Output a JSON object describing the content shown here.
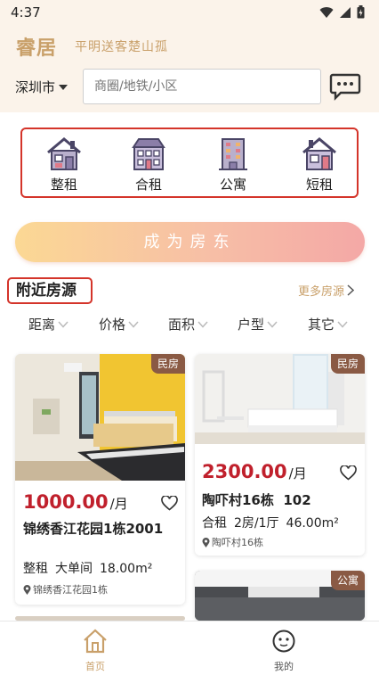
{
  "status": {
    "time": "4:37"
  },
  "brand": {
    "logo": "睿居",
    "slogan": "平明送客楚山孤"
  },
  "search": {
    "city": "深圳市",
    "placeholder": "商圈/地铁/小区"
  },
  "categories": [
    {
      "label": "整租",
      "icon": "house-icon"
    },
    {
      "label": "合租",
      "icon": "shared-building-icon"
    },
    {
      "label": "公寓",
      "icon": "apartment-icon"
    },
    {
      "label": "短租",
      "icon": "short-stay-house-icon"
    }
  ],
  "cta": {
    "label": "成为房东"
  },
  "nearby": {
    "title": "附近房源",
    "more": "更多房源"
  },
  "filters": [
    "距离",
    "价格",
    "面积",
    "户型",
    "其它"
  ],
  "listings": [
    {
      "tag": "民房",
      "price": "1000.00",
      "unit": "/月",
      "title": "锦绣香江花园1栋2001",
      "type": "整租",
      "layout": "大单间",
      "area": "18.00m²",
      "location": "锦绣香江花园1栋"
    },
    {
      "tag": "民房",
      "price": "2300.00",
      "unit": "/月",
      "title": "陶吓村16栋  102",
      "type": "合租",
      "layout": "2房/1厅",
      "area": "46.00m²",
      "location": "陶吓村16栋"
    },
    {
      "tag": "公寓"
    }
  ],
  "tabbar": [
    {
      "label": "首页",
      "icon": "home-icon",
      "active": true
    },
    {
      "label": "我的",
      "icon": "profile-face-icon",
      "active": false
    }
  ],
  "colors": {
    "accent": "#c9a06a",
    "price": "#c0202c",
    "tag": "#8a5a44",
    "highlight_border": "#d4342a"
  }
}
